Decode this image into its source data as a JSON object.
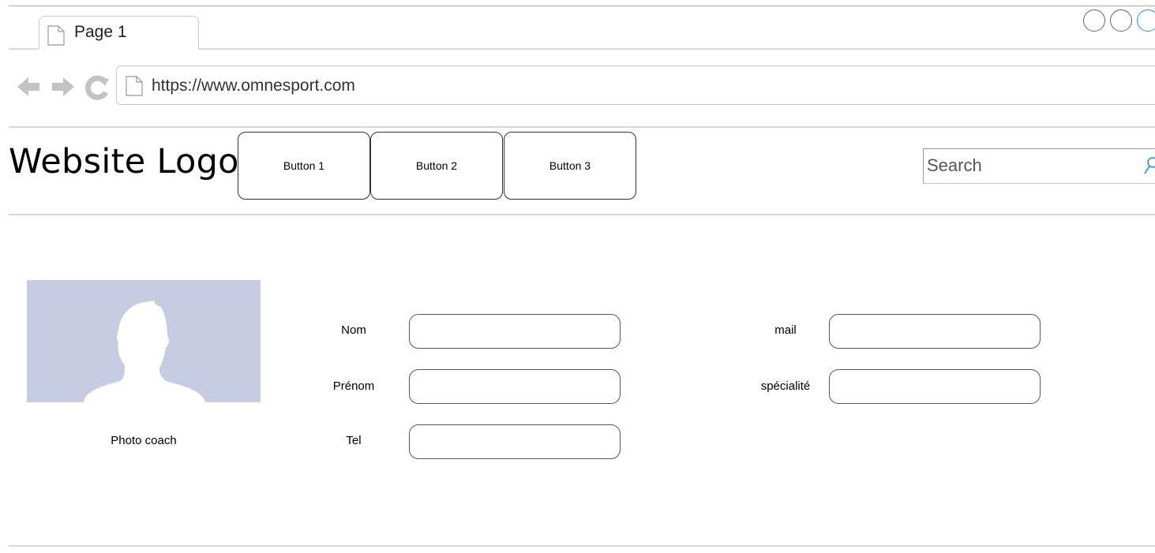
{
  "browser": {
    "tab_label": "Page 1",
    "url": "https://www.omnesport.com",
    "accent_color": "#1e90ff"
  },
  "header": {
    "logo_text": "Website Logo",
    "buttons": [
      "Button 1",
      "Button 2",
      "Button 3"
    ],
    "search_placeholder": "Search"
  },
  "profile": {
    "photo_label": "Photo coach",
    "photo_bg_color": "#c6cde2"
  },
  "form": {
    "fields": [
      {
        "label": "Nom",
        "value": ""
      },
      {
        "label": "Prénom",
        "value": ""
      },
      {
        "label": "Tel",
        "value": ""
      },
      {
        "label": "mail",
        "value": ""
      },
      {
        "label": "spécialité",
        "value": ""
      }
    ]
  }
}
